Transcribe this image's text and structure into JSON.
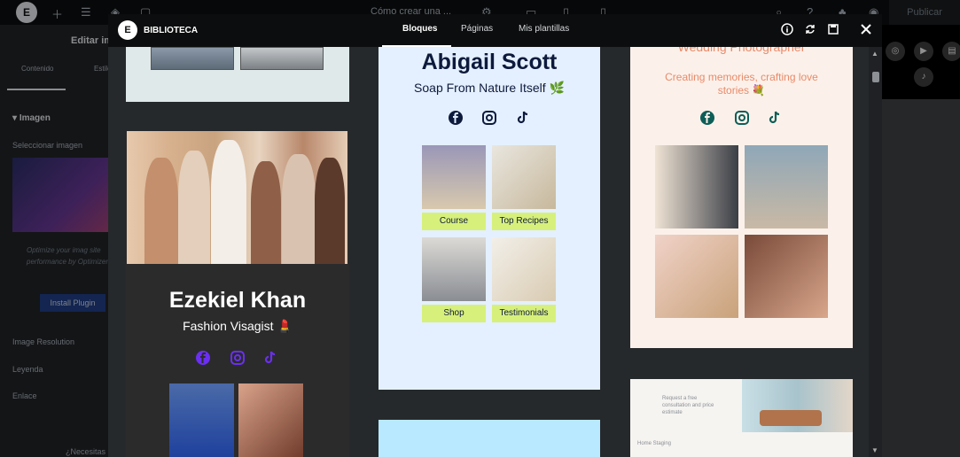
{
  "editor": {
    "logo": "E",
    "doc_title": "Cómo crear una ...",
    "publish_label": "Publicar",
    "panel_title": "Editar im",
    "tab_content": "Contenido",
    "tab_style": "Estilo",
    "section_title": "Imagen",
    "select_image_label": "Seleccionar imagen",
    "promo_text": "Optimize your imag site performance by Optimizer.",
    "install_plugin_label": "Install Plugin",
    "image_resolution_label": "Image Resolution",
    "caption_label": "Leyenda",
    "link_label": "Enlace",
    "help_label": "¿Necesitas ayuda?"
  },
  "library": {
    "title": "BIBLIOTECA",
    "tabs": [
      {
        "label": "Bloques",
        "active": true
      },
      {
        "label": "Páginas",
        "active": false
      },
      {
        "label": "Mis plantillas",
        "active": false
      }
    ],
    "header_icons": [
      "info-icon",
      "sync-icon",
      "save-icon",
      "close-icon"
    ]
  },
  "templates": {
    "ezekiel": {
      "name": "Ezekiel Khan",
      "subtitle": "Fashion Visagist 💄",
      "socials": [
        "facebook-icon",
        "instagram-icon",
        "tiktok-icon"
      ]
    },
    "abigail": {
      "name": "Abigail Scott",
      "subtitle": "Soap From Nature Itself 🌿",
      "socials": [
        "facebook-icon",
        "instagram-icon",
        "tiktok-icon"
      ],
      "buttons": [
        "Course",
        "Top Recipes",
        "Shop",
        "Testimonials"
      ]
    },
    "wedding": {
      "name": "Wedding Photographer",
      "subtitle": "Creating memories, crafting love stories 💐",
      "socials": [
        "facebook-icon",
        "instagram-icon",
        "tiktok-icon"
      ]
    },
    "interior": {
      "heading": "Request a free consultation and price estimate",
      "footer": "Home Staging"
    }
  },
  "colors": {
    "accent_purple": "#6b2ff2",
    "soap_green": "#d7f07b",
    "wedding_coral": "#ea8a6a",
    "wedding_teal": "#0d5e57"
  }
}
